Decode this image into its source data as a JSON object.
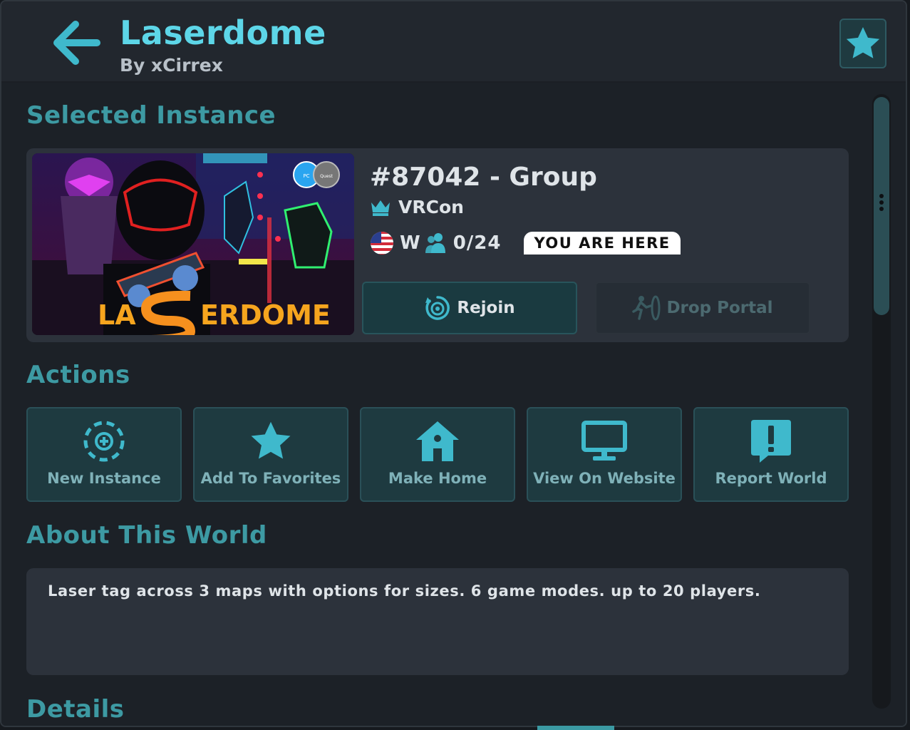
{
  "world": {
    "title": "Laserdome",
    "author": "By xCirrex"
  },
  "sections": {
    "selected_instance": "Selected Instance",
    "actions": "Actions",
    "about": "About This World",
    "details": "Details"
  },
  "instance": {
    "id_label": "#87042 - Group",
    "group_name": "VRCon",
    "region": "W",
    "player_count": "0/24",
    "here_badge": "YOU ARE HERE",
    "rejoin_label": "Rejoin",
    "drop_portal_label": "Drop Portal",
    "thumbnail": {
      "logo_left": "LA",
      "logo_right": "ERDOME",
      "platform_pc": "PC",
      "platform_quest": "Quest"
    }
  },
  "actions": [
    {
      "label": "New Instance",
      "icon": "new-instance-icon"
    },
    {
      "label": "Add To Favorites",
      "icon": "star-icon"
    },
    {
      "label": "Make Home",
      "icon": "home-icon"
    },
    {
      "label": "View On Website",
      "icon": "monitor-icon"
    },
    {
      "label": "Report World",
      "icon": "report-icon"
    }
  ],
  "about_text": "Laser tag across 3 maps with options for sizes. 6 game modes. up to 20 players.",
  "colors": {
    "accent": "#5dd6e8",
    "section_title": "#3d9aa3",
    "button_bg": "#1e3a40",
    "panel_bg": "#22272e"
  }
}
